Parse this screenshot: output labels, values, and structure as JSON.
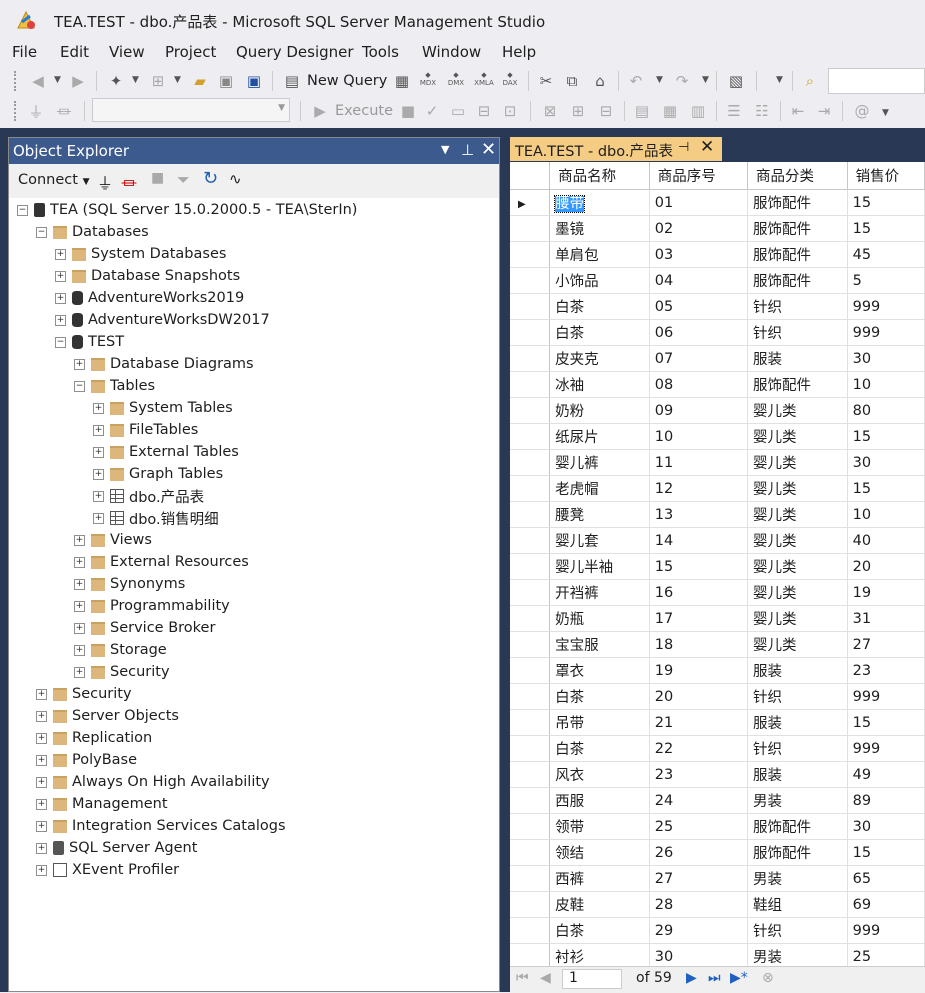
{
  "window": {
    "title": "TEA.TEST - dbo.产品表 - Microsoft SQL Server Management Studio"
  },
  "menu": [
    "File",
    "Edit",
    "View",
    "Project",
    "Query Designer",
    "Tools",
    "Window",
    "Help"
  ],
  "toolbar": {
    "new_query_label": "New Query",
    "execute_label": "Execute",
    "mdx": "MDX",
    "dmx": "DMX",
    "xmla": "XMLA",
    "dax": "DAX"
  },
  "object_explorer": {
    "title": "Object Explorer",
    "connect_label": "Connect",
    "nodes": [
      {
        "label": "TEA (SQL Server 15.0.2000.5 - TEA\\SterIn)",
        "level": 0,
        "icon": "server-icon",
        "expander": "−"
      },
      {
        "label": "Databases",
        "level": 1,
        "icon": "folder-icon",
        "expander": "−"
      },
      {
        "label": "System Databases",
        "level": 2,
        "icon": "folder-icon",
        "expander": "+"
      },
      {
        "label": "Database Snapshots",
        "level": 2,
        "icon": "folder-icon",
        "expander": "+"
      },
      {
        "label": "AdventureWorks2019",
        "level": 2,
        "icon": "database-icon",
        "expander": "+"
      },
      {
        "label": "AdventureWorksDW2017",
        "level": 2,
        "icon": "database-icon",
        "expander": "+"
      },
      {
        "label": "TEST",
        "level": 2,
        "icon": "database-icon",
        "expander": "−"
      },
      {
        "label": "Database Diagrams",
        "level": 3,
        "icon": "folder-icon",
        "expander": "+"
      },
      {
        "label": "Tables",
        "level": 3,
        "icon": "folder-icon",
        "expander": "−"
      },
      {
        "label": "System Tables",
        "level": 4,
        "icon": "folder-icon",
        "expander": "+"
      },
      {
        "label": "FileTables",
        "level": 4,
        "icon": "folder-icon",
        "expander": "+"
      },
      {
        "label": "External Tables",
        "level": 4,
        "icon": "folder-icon",
        "expander": "+"
      },
      {
        "label": "Graph Tables",
        "level": 4,
        "icon": "folder-icon",
        "expander": "+"
      },
      {
        "label": "dbo.产品表",
        "level": 4,
        "icon": "table-icon",
        "expander": "+"
      },
      {
        "label": "dbo.销售明细",
        "level": 4,
        "icon": "table-icon",
        "expander": "+"
      },
      {
        "label": "Views",
        "level": 3,
        "icon": "folder-icon",
        "expander": "+"
      },
      {
        "label": "External Resources",
        "level": 3,
        "icon": "folder-icon",
        "expander": "+"
      },
      {
        "label": "Synonyms",
        "level": 3,
        "icon": "folder-icon",
        "expander": "+"
      },
      {
        "label": "Programmability",
        "level": 3,
        "icon": "folder-icon",
        "expander": "+"
      },
      {
        "label": "Service Broker",
        "level": 3,
        "icon": "folder-icon",
        "expander": "+"
      },
      {
        "label": "Storage",
        "level": 3,
        "icon": "folder-icon",
        "expander": "+"
      },
      {
        "label": "Security",
        "level": 3,
        "icon": "folder-icon",
        "expander": "+"
      },
      {
        "label": "Security",
        "level": 1,
        "icon": "folder-icon",
        "expander": "+"
      },
      {
        "label": "Server Objects",
        "level": 1,
        "icon": "folder-icon",
        "expander": "+"
      },
      {
        "label": "Replication",
        "level": 1,
        "icon": "folder-icon",
        "expander": "+"
      },
      {
        "label": "PolyBase",
        "level": 1,
        "icon": "folder-icon",
        "expander": "+"
      },
      {
        "label": "Always On High Availability",
        "level": 1,
        "icon": "folder-icon",
        "expander": "+"
      },
      {
        "label": "Management",
        "level": 1,
        "icon": "folder-icon",
        "expander": "+"
      },
      {
        "label": "Integration Services Catalogs",
        "level": 1,
        "icon": "folder-icon",
        "expander": "+"
      },
      {
        "label": "SQL Server Agent",
        "level": 1,
        "icon": "agent-icon",
        "expander": "+"
      },
      {
        "label": "XEvent Profiler",
        "level": 1,
        "icon": "xevent-icon",
        "expander": "+"
      }
    ]
  },
  "document_tab": {
    "label": "TEA.TEST - dbo.产品表",
    "pin_icon": "pin-icon",
    "close_icon": "close-icon"
  },
  "result_grid": {
    "columns": [
      "商品名称",
      "商品序号",
      "商品分类",
      "销售价"
    ],
    "rows": [
      [
        "腰带",
        "01",
        "服饰配件",
        "15"
      ],
      [
        "墨镜",
        "02",
        "服饰配件",
        "15"
      ],
      [
        "单肩包",
        "03",
        "服饰配件",
        "45"
      ],
      [
        "小饰品",
        "04",
        "服饰配件",
        "5"
      ],
      [
        "白茶",
        "05",
        "针织",
        "999"
      ],
      [
        "白茶",
        "06",
        "针织",
        "999"
      ],
      [
        "皮夹克",
        "07",
        "服装",
        "30"
      ],
      [
        "冰袖",
        "08",
        "服饰配件",
        "10"
      ],
      [
        "奶粉",
        "09",
        "婴儿类",
        "80"
      ],
      [
        "纸尿片",
        "10",
        "婴儿类",
        "15"
      ],
      [
        "婴儿裤",
        "11",
        "婴儿类",
        "30"
      ],
      [
        "老虎帽",
        "12",
        "婴儿类",
        "15"
      ],
      [
        "腰凳",
        "13",
        "婴儿类",
        "10"
      ],
      [
        "婴儿套",
        "14",
        "婴儿类",
        "40"
      ],
      [
        "婴儿半袖",
        "15",
        "婴儿类",
        "20"
      ],
      [
        "开裆裤",
        "16",
        "婴儿类",
        "19"
      ],
      [
        "奶瓶",
        "17",
        "婴儿类",
        "31"
      ],
      [
        "宝宝服",
        "18",
        "婴儿类",
        "27"
      ],
      [
        "罩衣",
        "19",
        "服装",
        "23"
      ],
      [
        "白茶",
        "20",
        "针织",
        "999"
      ],
      [
        "吊带",
        "21",
        "服装",
        "15"
      ],
      [
        "白茶",
        "22",
        "针织",
        "999"
      ],
      [
        "风衣",
        "23",
        "服装",
        "49"
      ],
      [
        "西服",
        "24",
        "男装",
        "89"
      ],
      [
        "领带",
        "25",
        "服饰配件",
        "30"
      ],
      [
        "领结",
        "26",
        "服饰配件",
        "15"
      ],
      [
        "西裤",
        "27",
        "男装",
        "65"
      ],
      [
        "皮鞋",
        "28",
        "鞋组",
        "69"
      ],
      [
        "白茶",
        "29",
        "针织",
        "999"
      ],
      [
        "衬衫",
        "30",
        "男装",
        "25"
      ]
    ]
  },
  "pager": {
    "current_page": "1",
    "of_label": "of 59"
  },
  "colors": {
    "oe_header": "#3c5a8d",
    "dock_bg": "#293955",
    "doc_tab": "#f5cc84",
    "selection": "#3399ff"
  }
}
